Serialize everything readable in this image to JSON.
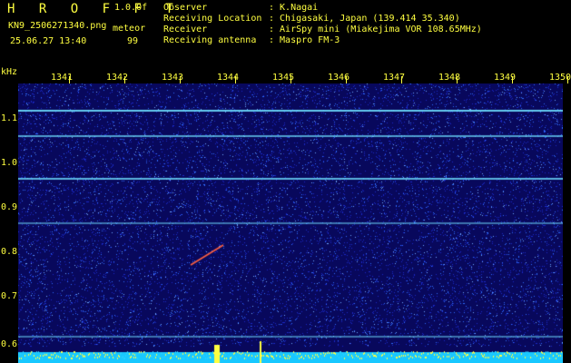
{
  "header": {
    "brand": "H R O F F T",
    "version": "1.0.0f",
    "filename": "KN9_2506271340.png",
    "mode": "meteor",
    "datetime": "25.06.27 13:40",
    "count": "99"
  },
  "info": {
    "observer_label": "Observer",
    "observer_value": ": K.Nagai",
    "location_label": "Receiving Location",
    "location_value": ": Chigasaki, Japan (139.414 35.340)",
    "receiver_label": "Receiver",
    "receiver_value": ": AirSpy mini (Miakejima VOR 108.65MHz)",
    "antenna_label": "Receiving antenna",
    "antenna_value": ": Maspro FM-3"
  },
  "axis": {
    "y_unit": "kHz",
    "x_ticks": [
      "1341",
      "1342",
      "1343",
      "1344",
      "1345",
      "1346",
      "1347",
      "1348",
      "1349",
      "1350"
    ],
    "y_ticks": [
      "1.1",
      "1.0",
      "0.9",
      "0.8",
      "0.7",
      "0.6"
    ]
  },
  "colors": {
    "background": "#08085c",
    "text": "#ffff40",
    "signal_line": "#6fe0ff",
    "bottom_band": "#18c8ff"
  }
}
